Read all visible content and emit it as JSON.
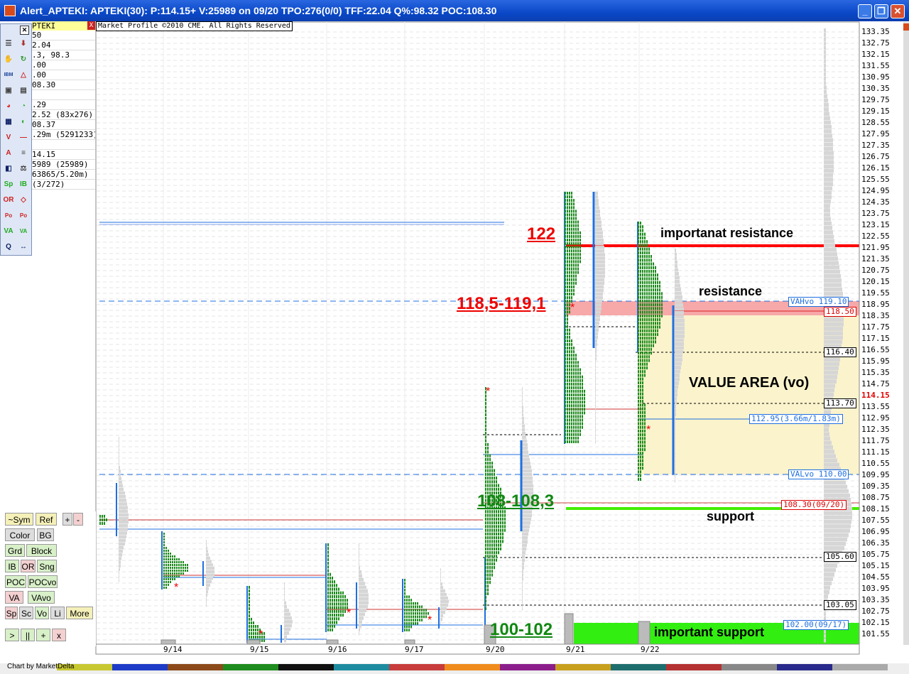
{
  "window": {
    "title": "Alert_APTEKI: APTEKI(30): P:114.15+ V:25989 on 09/20 TPO:276(0/0) TFF:22.04 Q%:98.32 POC:108.30",
    "minimize": "_",
    "restore": "❐",
    "close": "✕"
  },
  "panel": {
    "symbol": "PTEKI",
    "close_x": "X",
    "copyright": "Market Profile ©2010 CME. All Rights Reserved",
    "info_rows": [
      "50",
      "2.04",
      ".3, 98.3",
      ".00",
      ".00",
      "08.30",
      "",
      ".29",
      "2.52 (83x276)",
      "08.37",
      ".29m (5291233)",
      "",
      "14.15",
      "5989 (25989)",
      "63865/5.20m)",
      " (3/272)"
    ]
  },
  "price_axis": {
    "labels": [
      "133.35",
      "132.75",
      "132.15",
      "131.55",
      "130.95",
      "130.35",
      "129.75",
      "129.15",
      "128.55",
      "127.95",
      "127.35",
      "126.75",
      "126.15",
      "125.55",
      "124.95",
      "124.35",
      "123.75",
      "123.15",
      "122.55",
      "121.95",
      "121.35",
      "120.75",
      "120.15",
      "119.55",
      "118.95",
      "118.35",
      "117.75",
      "117.15",
      "116.55",
      "115.95",
      "115.35",
      "114.75",
      "114.15",
      "113.55",
      "112.95",
      "112.35",
      "111.75",
      "111.15",
      "110.55",
      "109.95",
      "109.35",
      "108.75",
      "108.15",
      "107.55",
      "106.95",
      "106.35",
      "105.75",
      "105.15",
      "104.55",
      "103.95",
      "103.35",
      "102.75",
      "102.15",
      "101.55"
    ],
    "current_price": "114.15",
    "current_color": "#e00000"
  },
  "tags": {
    "vah": "VAHvo 119.10",
    "r1850": "118.50",
    "r1640": "116.40",
    "r1370": "113.70",
    "poc": "112.95(3.66m/1.83m)",
    "val": "VALvo 110.00",
    "s10830": "108.30(09/20)",
    "s10560": "105.60",
    "s10305": "103.05",
    "s10200": "102.00(09/17)"
  },
  "annotations": {
    "a122": "122",
    "important_resistance": "importanat resistance",
    "a1185": "118,5-119,1",
    "resistance": "resistance",
    "value_area": "VALUE AREA (vo)",
    "a108": "108-108,3",
    "support": "support",
    "a100": "100-102",
    "important_support": "important support"
  },
  "dates": [
    "9/14",
    "9/15",
    "9/16",
    "9/17",
    "9/20",
    "9/21",
    "9/22"
  ],
  "buttons": {
    "sym": "~Sym",
    "ref": "Ref",
    "plus": "+",
    "minus": "-",
    "color": "Color",
    "bg": "BG",
    "grd": "Grd",
    "block": "Block",
    "ib": "IB",
    "or": "OR",
    "sng": "Sng",
    "poc": "POC",
    "pocvo": "POCvo",
    "va": "VA",
    "vavo": "VAvo",
    "sp": "Sp",
    "sc": "Sc",
    "vo": "Vo",
    "li": "Li",
    "more": "More",
    "play": ">",
    "pause": "||",
    "add": "+",
    "x": "x"
  },
  "footer": {
    "credit": "Chart by MarketDelta"
  },
  "colors": {
    "accent_red": "#ff0000",
    "support_green": "#22dd00",
    "value_area": "#fbf3cc",
    "profile_green": "#1a8a1a",
    "line_blue": "#1e6fe0"
  }
}
